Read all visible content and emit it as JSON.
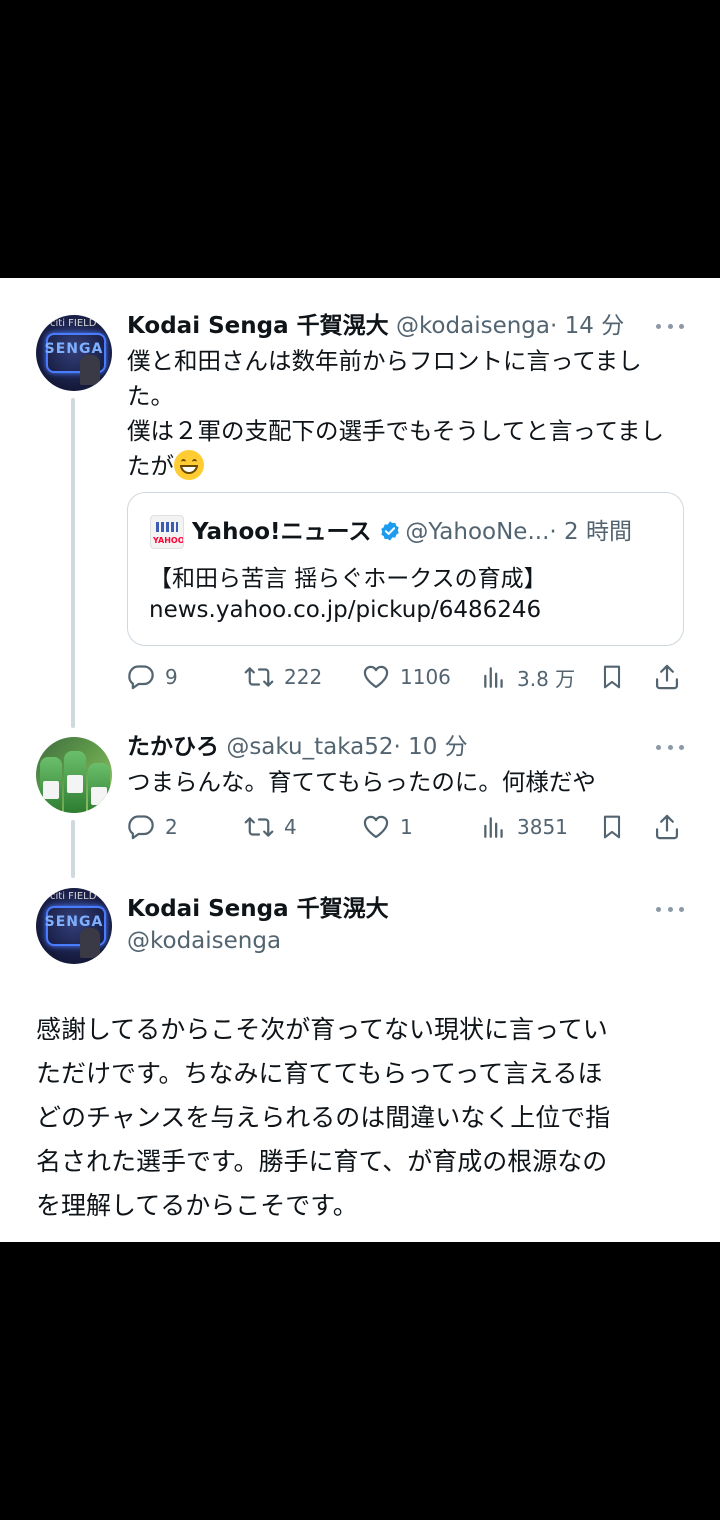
{
  "tweet1": {
    "name": "Kodai Senga 千賀滉大",
    "handle": "@kodaisenga",
    "time": "· 14 分",
    "lines": [
      "僕と和田さんは数年前からフロントに言ってまし",
      "た。",
      "僕は２軍の支配下の選手でもそうしてと言ってまし",
      "たが"
    ],
    "emoji": "grinning-face",
    "quote": {
      "name": "Yahoo!ニュース",
      "handle": "@YahooNe...",
      "time": "· 2 時間",
      "text": "【和田ら苦言 揺らぐホークスの育成】",
      "link": "news.yahoo.co.jp/pickup/6486246"
    },
    "actions": {
      "replies": "9",
      "retweets": "222",
      "likes": "1106",
      "views": "3.8 万"
    }
  },
  "tweet2": {
    "name": "たかひろ",
    "handle": "@saku_taka52",
    "time": "· 10 分",
    "text": "つまらんな。育ててもらったのに。何様だや",
    "actions": {
      "replies": "2",
      "retweets": "4",
      "likes": "1",
      "views": "3851"
    }
  },
  "tweet3": {
    "name": "Kodai Senga 千賀滉大",
    "handle": "@kodaisenga",
    "lines": [
      "感謝してるからこそ次が育ってない現状に言ってい",
      "ただけです。ちなみに育ててもらってって言えるほ",
      "どのチャンスを与えられるのは間違いなく上位で指",
      "名された選手です。勝手に育て、が育成の根源なの",
      "を理解してるからこそです。"
    ]
  },
  "colors": {
    "text": "#0f1419",
    "secondary": "#536471",
    "verified": "#1d9bf0",
    "border": "#cfd9de"
  }
}
